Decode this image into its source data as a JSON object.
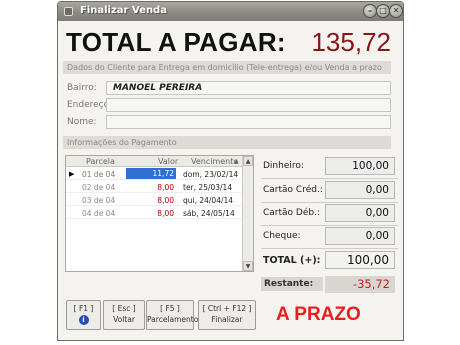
{
  "window": {
    "title": "Finalizar Venda"
  },
  "total": {
    "label": "TOTAL A PAGAR:",
    "value": "135,72"
  },
  "customer_section": "Dados do Cliente para Entrega em domicílio (Tele-entrega) e/ou Venda a prazo",
  "customer": {
    "bairro_label": "Bairro:",
    "bairro_value": "MANOEL PEREIRA",
    "endereco_label": "Endereço:",
    "endereco_value": "",
    "nome_label": "Nome:",
    "nome_value": ""
  },
  "payment_section": "Informações do Pagamento",
  "installments": {
    "headers": [
      "Parcela",
      "Valor",
      "Vencimento"
    ],
    "rows": [
      {
        "parcela": "01 de 04",
        "valor": "11,72",
        "vencimento": "dom, 23/02/14"
      },
      {
        "parcela": "02 de 04",
        "valor": "8,00",
        "vencimento": "ter, 25/03/14"
      },
      {
        "parcela": "03 de 04",
        "valor": "8,00",
        "vencimento": "qui, 24/04/14"
      },
      {
        "parcela": "04 de 04",
        "valor": "8,00",
        "vencimento": "sáb, 24/05/14"
      }
    ]
  },
  "payments": {
    "dinheiro_label": "Dinheiro:",
    "dinheiro_value": "100,00",
    "cartao_cred_label": "Cartão Créd.:",
    "cartao_cred_value": "0,00",
    "cartao_deb_label": "Cartão Déb.:",
    "cartao_deb_value": "0,00",
    "cheque_label": "Cheque:",
    "cheque_value": "0,00",
    "total_label": "TOTAL (+):",
    "total_value": "100,00",
    "restante_label": "Restante:",
    "restante_value": "-35,72"
  },
  "buttons": {
    "f1_key": "[ F1 ]",
    "esc_key": "[ Esc ]",
    "esc_label": "Voltar",
    "f5_key": "[ F5 ]",
    "f5_label": "Parcelamento",
    "f12_key": "[ Ctrl + F12 ]",
    "f12_label": "Finalizar"
  },
  "status": "A PRAZO",
  "colors": {
    "total_value": "#8b1414",
    "status": "#e81d1d",
    "restante": "#cc1d1d",
    "selected": "#2f6fd0"
  }
}
